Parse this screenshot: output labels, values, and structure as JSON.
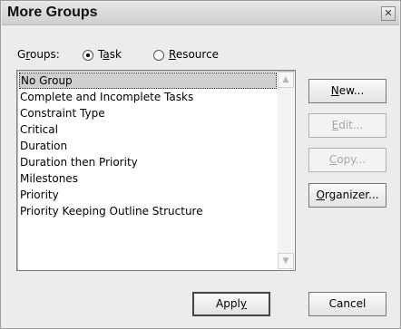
{
  "window": {
    "title": "More Groups",
    "close_glyph": "✕"
  },
  "groups": {
    "label_pre": "G",
    "label_mnemonic": "r",
    "label_post": "oups:",
    "task": {
      "pre": "T",
      "mnemonic": "a",
      "post": "sk"
    },
    "resource": {
      "pre": "",
      "mnemonic": "R",
      "post": "esource"
    },
    "selected": "Task"
  },
  "list": {
    "items": [
      "No Group",
      "Complete and Incomplete Tasks",
      "Constraint Type",
      "Critical",
      "Duration",
      "Duration then Priority",
      "Milestones",
      "Priority",
      "Priority Keeping Outline Structure"
    ],
    "selected_index": 0,
    "scroll_up_glyph": "▲",
    "scroll_down_glyph": "▼"
  },
  "buttons": {
    "new": {
      "pre": "",
      "mnemonic": "N",
      "post": "ew..."
    },
    "edit": {
      "pre": "",
      "mnemonic": "E",
      "post": "dit..."
    },
    "copy": {
      "pre": "",
      "mnemonic": "C",
      "post": "opy..."
    },
    "organizer": {
      "pre": "",
      "mnemonic": "O",
      "post": "rganizer..."
    },
    "apply": {
      "pre": "Appl",
      "mnemonic": "y",
      "post": ""
    },
    "cancel": {
      "label": "Cancel"
    }
  }
}
